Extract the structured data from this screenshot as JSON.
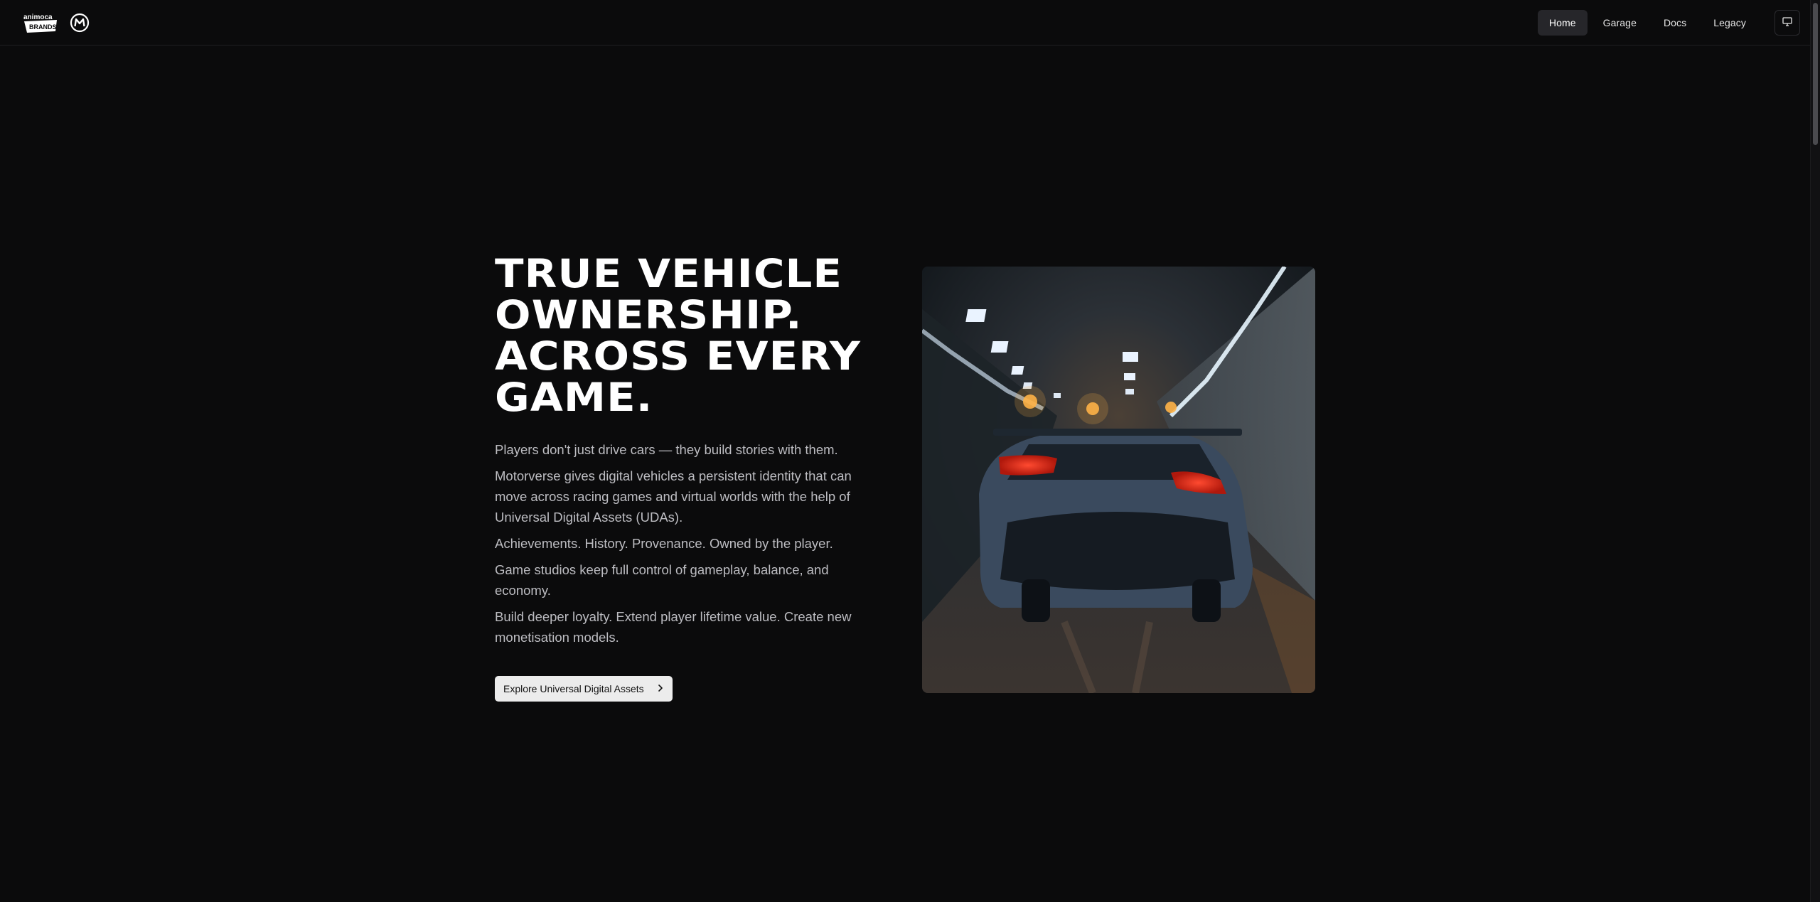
{
  "brand": {
    "partner_logo": "animoca BRANDS",
    "logo_icon": "motorverse-m-logo"
  },
  "nav": {
    "items": [
      {
        "label": "Home",
        "active": true
      },
      {
        "label": "Garage",
        "active": false
      },
      {
        "label": "Docs",
        "active": false
      },
      {
        "label": "Legacy",
        "active": false
      }
    ],
    "theme_toggle_icon": "monitor-icon"
  },
  "hero": {
    "headline": "TRUE VEHICLE OWNERSHIP. ACROSS EVERY GAME.",
    "paragraphs": [
      "Players don't just drive cars — they build stories with them.",
      "Motorverse gives digital vehicles a persistent identity that can move across racing games and virtual worlds with the help of Universal Digital Assets (UDAs).",
      "Achievements. History. Provenance. Owned by the player.",
      "Game studios keep full control of gameplay, balance, and economy.",
      "Build deeper loyalty. Extend player lifetime value. Create new monetisation models."
    ],
    "cta_label": "Explore Universal Digital Assets",
    "cta_icon": "chevron-right-icon",
    "image_subject": "sports car driving through tunnel"
  },
  "colors": {
    "background": "#0b0b0c",
    "nav_active": "#26262a",
    "cta_bg": "#ececec",
    "text_muted": "#bdbdc2"
  }
}
